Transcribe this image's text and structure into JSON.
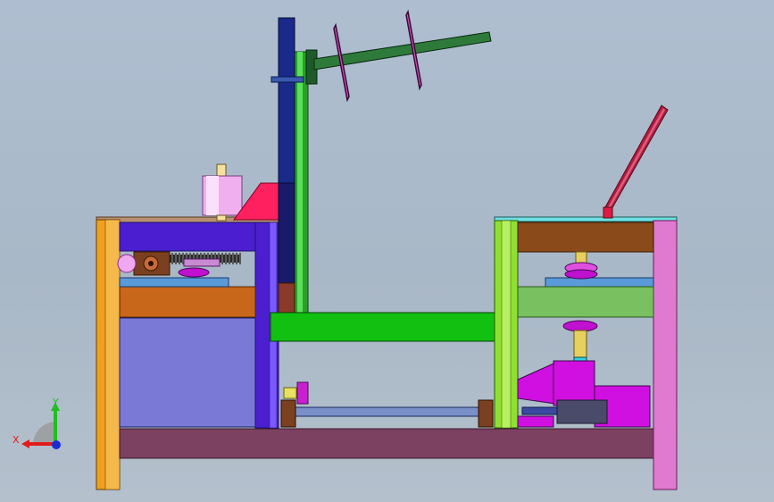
{
  "viewport": {
    "background_top": "#aebed0",
    "background_bottom": "#b4c0cc"
  },
  "triad": {
    "x_label": "X",
    "y_label": "Y",
    "x_color": "#e21b1b",
    "y_color": "#1fbf1f",
    "z_color": "#1a2bd6"
  },
  "colors": {
    "left_frame_leg": "#f0a020",
    "left_panel": "#7a7ad6",
    "left_top_beam": "#4b1fd0",
    "left_mid_beam": "#c8661a",
    "base_beam": "#7c4060",
    "right_frame_leg": "#e07ad0",
    "right_green_frame": "#8fe030",
    "right_top_beam": "#8a4a1a",
    "right_mid_beam": "#78c060",
    "center_beam": "#11c011",
    "vertical_column": "#1a2a8a",
    "belt": "#2aa02a",
    "reel_shaft": "#2e7a3a",
    "reel_disk": "#d050b0",
    "motor": "#d010e0",
    "wedge": "#ff2060",
    "spool": "#f0b0f0",
    "lever": "#b01c40",
    "shaft_bottom": "#7a90c8",
    "bearing_block": "#7a4020",
    "accent_cyan": "#30d0e0"
  },
  "components": {
    "hint_text": ""
  }
}
